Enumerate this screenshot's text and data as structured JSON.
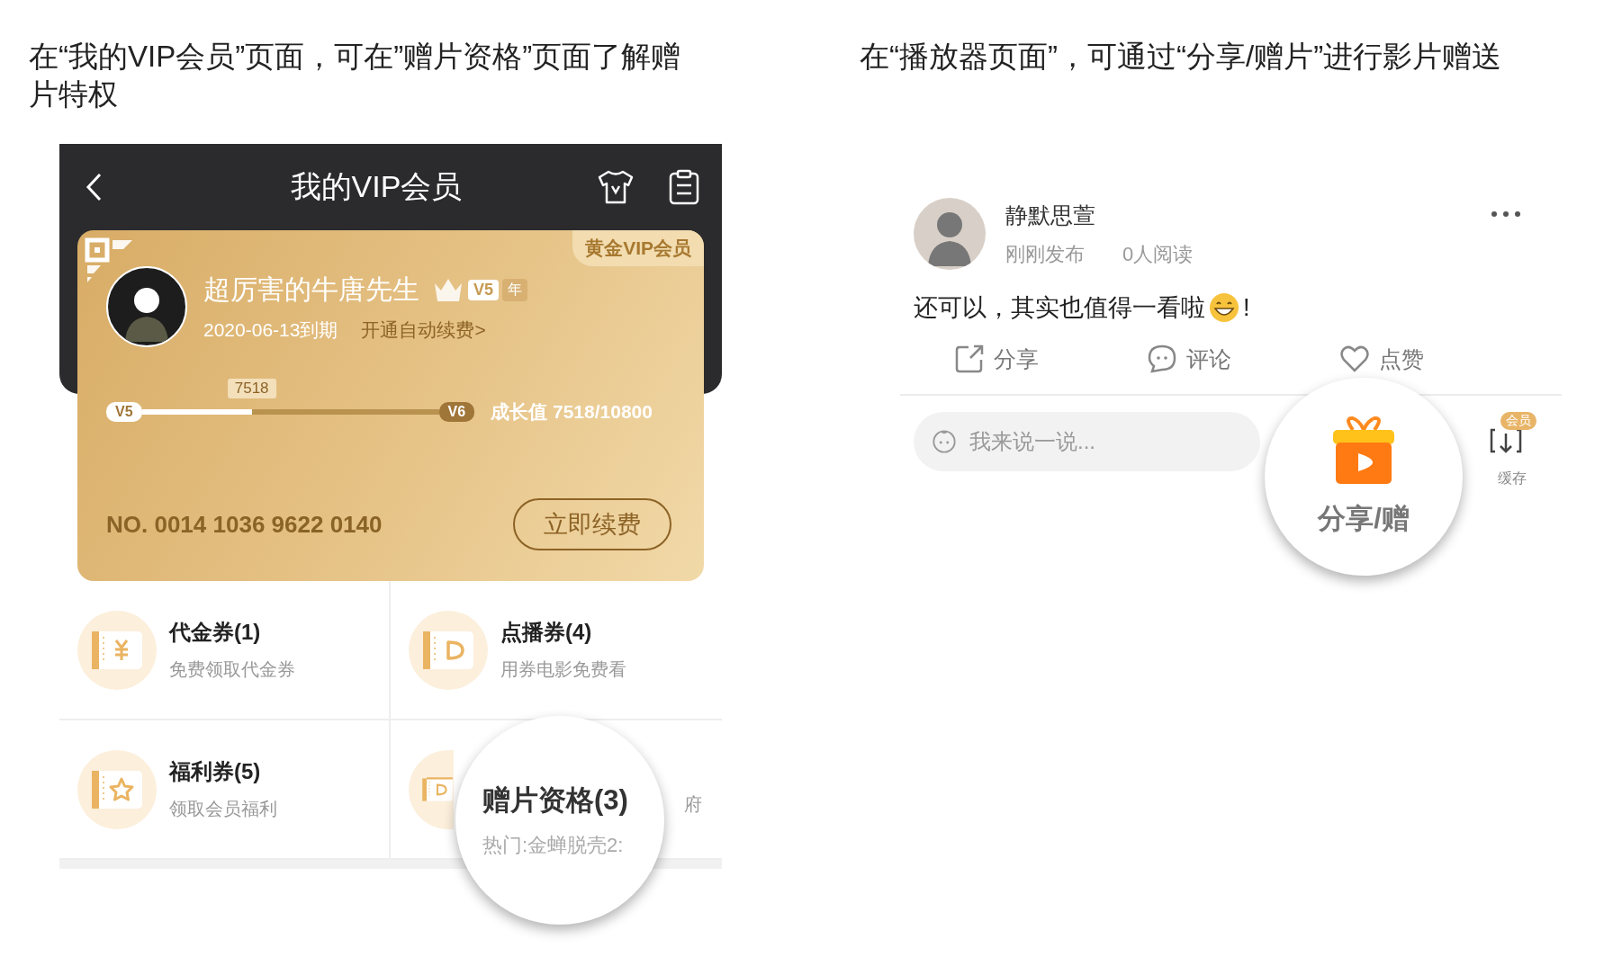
{
  "left": {
    "caption": "在“我的VIP会员”页面，可在”赠片资格”页面了解赠片特权",
    "header": {
      "title": "我的VIP会员"
    },
    "card": {
      "badge": "黄金VIP会员",
      "username": "超厉害的牛唐先生",
      "level_badge": "V5",
      "year_badge": "年",
      "expiry": "2020-06-13到期",
      "auto_renew": "开通自动续费>",
      "progress": {
        "current_label": "7518",
        "from": "V5",
        "to": "V6",
        "level": 0.37,
        "reading": "成长值 7518/10800"
      },
      "number": "NO. 0014 1036 9622 0140",
      "renew_button": "立即续费"
    },
    "grid": [
      {
        "kind": "yuan",
        "title": "代金券(1)",
        "subtitle": "免费领取代金券"
      },
      {
        "kind": "play",
        "title": "点播券(4)",
        "subtitle": "用券电影免费看"
      },
      {
        "kind": "star",
        "title": "福利券(5)",
        "subtitle": "领取会员福利"
      },
      {
        "kind": "gift",
        "subtitle": "府"
      }
    ],
    "magnifier": {
      "title": "赠片资格(3)",
      "subtitle": "热门:金蝉脱壳2:"
    }
  },
  "right": {
    "caption": "在“播放器页面”，可通过“分享/赠片”进行影片赠送",
    "post": {
      "author": "静默思萱",
      "time": "刚刚发布",
      "reads": "0人阅读",
      "text": "还可以，其实也值得一看啦",
      "text_end": "!",
      "actions": [
        {
          "kind": "share",
          "label": "分享"
        },
        {
          "kind": "comment",
          "label": "评论"
        },
        {
          "kind": "like",
          "label": "点赞"
        }
      ]
    },
    "comment_bar": {
      "placeholder": "我来说一说..."
    },
    "cache": {
      "badge": "会员",
      "label": "缓存"
    },
    "magnifier": {
      "label": "分享/赠"
    }
  }
}
